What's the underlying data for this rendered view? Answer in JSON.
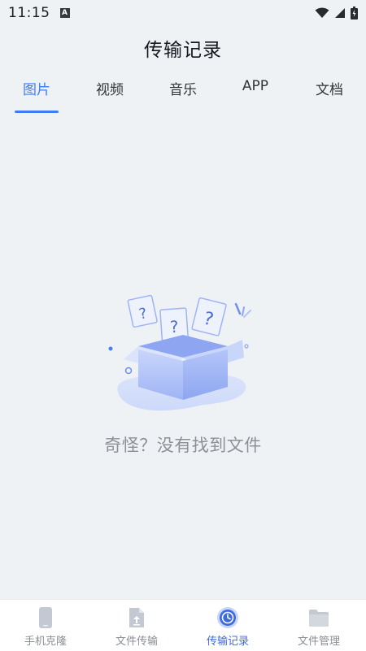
{
  "status_bar": {
    "time": "11:15",
    "notification_icon": "A",
    "icons": [
      "wifi-icon",
      "signal-icon",
      "battery-icon"
    ]
  },
  "header": {
    "title": "传输记录"
  },
  "tabs": [
    {
      "label": "图片",
      "active": true
    },
    {
      "label": "视频",
      "active": false
    },
    {
      "label": "音乐",
      "active": false
    },
    {
      "label": "APP",
      "active": false
    },
    {
      "label": "文档",
      "active": false
    }
  ],
  "empty_state": {
    "message": "奇怪？没有找到文件",
    "illustration": "empty-box-illustration"
  },
  "bottom_nav": [
    {
      "label": "手机克隆",
      "icon": "phone-icon",
      "active": false
    },
    {
      "label": "文件传输",
      "icon": "file-upload-icon",
      "active": false
    },
    {
      "label": "传输记录",
      "icon": "clock-icon",
      "active": true
    },
    {
      "label": "文件管理",
      "icon": "folder-icon",
      "active": false
    }
  ],
  "colors": {
    "accent": "#3d7bf7",
    "background": "#eff2f5",
    "muted_text": "#8c9096"
  }
}
